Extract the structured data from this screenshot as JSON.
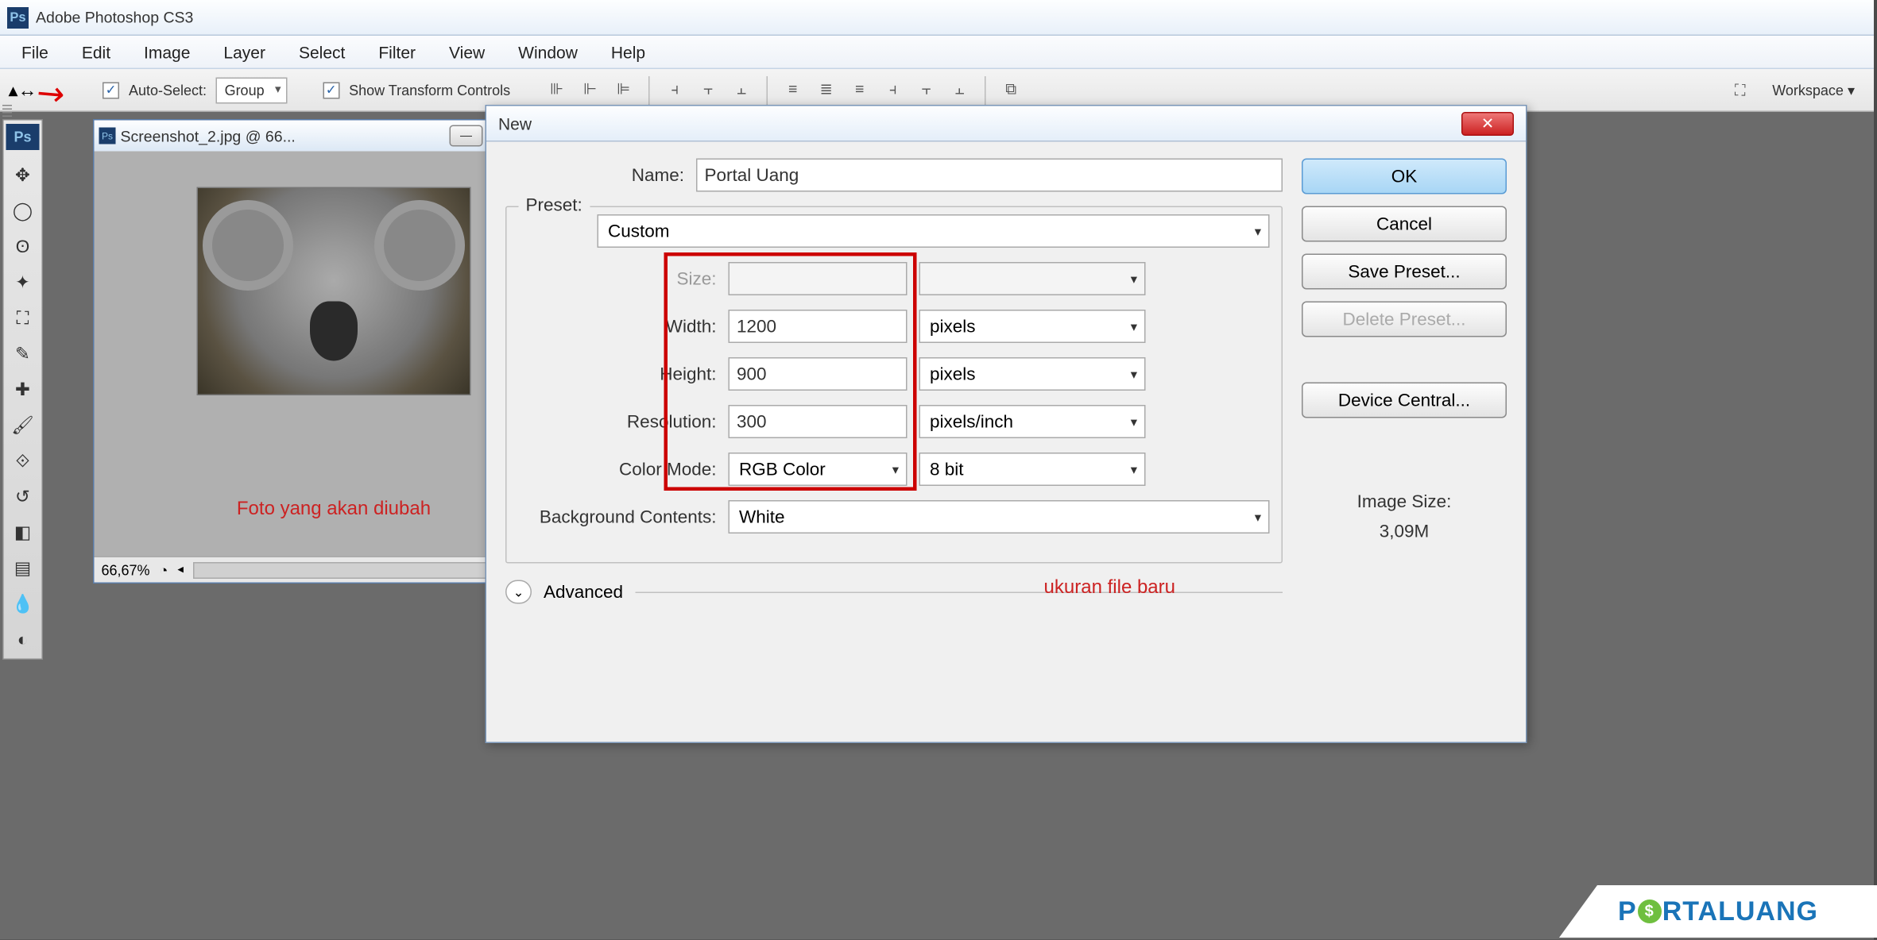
{
  "app": {
    "title": "Adobe Photoshop CS3"
  },
  "menu": [
    "File",
    "Edit",
    "Image",
    "Layer",
    "Select",
    "Filter",
    "View",
    "Window",
    "Help"
  ],
  "options": {
    "auto_select": "Auto-Select:",
    "group": "Group",
    "show_transform": "Show Transform Controls",
    "workspace": "Workspace ▾"
  },
  "tools": [
    "move",
    "marquee",
    "lasso",
    "wand",
    "crop",
    "slice",
    "patch",
    "brush",
    "stamp",
    "history",
    "eraser",
    "gradient",
    "blur",
    "dodge"
  ],
  "doc": {
    "title": "Screenshot_2.jpg @ 66...",
    "caption": "Foto yang akan diubah",
    "zoom": "66,67%"
  },
  "dialog": {
    "title": "New",
    "name_label": "Name:",
    "name_value": "Portal Uang",
    "preset_label": "Preset:",
    "preset_value": "Custom",
    "size_label": "Size:",
    "width_label": "Width:",
    "width_value": "1200",
    "width_unit": "pixels",
    "height_label": "Height:",
    "height_value": "900",
    "height_unit": "pixels",
    "res_label": "Resolution:",
    "res_value": "300",
    "res_unit": "pixels/inch",
    "color_label": "Color Mode:",
    "color_value": "RGB Color",
    "color_depth": "8 bit",
    "bg_label": "Background Contents:",
    "bg_value": "White",
    "advanced": "Advanced",
    "anno": "ukuran file baru",
    "imgsize_label": "Image Size:",
    "imgsize_value": "3,09M",
    "ok": "OK",
    "cancel": "Cancel",
    "save_preset": "Save Preset...",
    "delete_preset": "Delete Preset...",
    "device_central": "Device Central..."
  },
  "watermark": {
    "text": "PORTALUANG"
  }
}
